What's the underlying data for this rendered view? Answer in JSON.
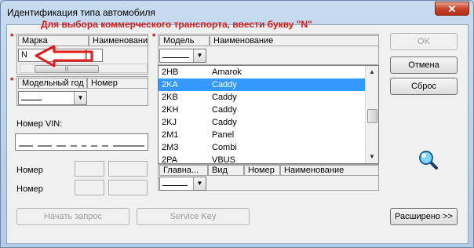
{
  "window": {
    "title": "Идентификация типа автомобиля",
    "close_glyph": "✕"
  },
  "annotation": {
    "text": "Для выбора коммерческого транспорта, ввести букву \"N\"",
    "color": "#d21c1c"
  },
  "required_marker": "*",
  "left": {
    "headers": [
      "Марка",
      "Наименование"
    ],
    "marka_value": "N",
    "model_year_headers": [
      "Модельный год",
      "Номер"
    ],
    "vin_label": "Номер VIN:",
    "nomer_label_1": "Номер",
    "nomer_label_2": "Номер"
  },
  "model": {
    "headers": [
      "Модель",
      "Наименование"
    ],
    "list_rows": [
      {
        "code": "2HB",
        "name": "Amarok",
        "selected": false
      },
      {
        "code": "2KA",
        "name": "Caddy",
        "selected": true
      },
      {
        "code": "2KB",
        "name": "Caddy",
        "selected": false
      },
      {
        "code": "2KH",
        "name": "Caddy",
        "selected": false
      },
      {
        "code": "2KJ",
        "name": "Caddy",
        "selected": false
      },
      {
        "code": "2M1",
        "name": "Panel",
        "selected": false
      },
      {
        "code": "2M3",
        "name": "Combi",
        "selected": false
      },
      {
        "code": "2PA",
        "name": "VBUS",
        "selected": false
      }
    ],
    "bottom_headers": [
      "Главна...",
      "Вид",
      "Номер",
      "Наименование"
    ]
  },
  "buttons": {
    "ok": "OK",
    "cancel": "Отмена",
    "reset": "Сброс",
    "start_query": "Начать запрос",
    "service_key": "Service Key",
    "advanced": "Расширено >>"
  },
  "colors": {
    "selection": "#3399ff",
    "arrow": "#e01b1b",
    "required": "#c00000"
  }
}
